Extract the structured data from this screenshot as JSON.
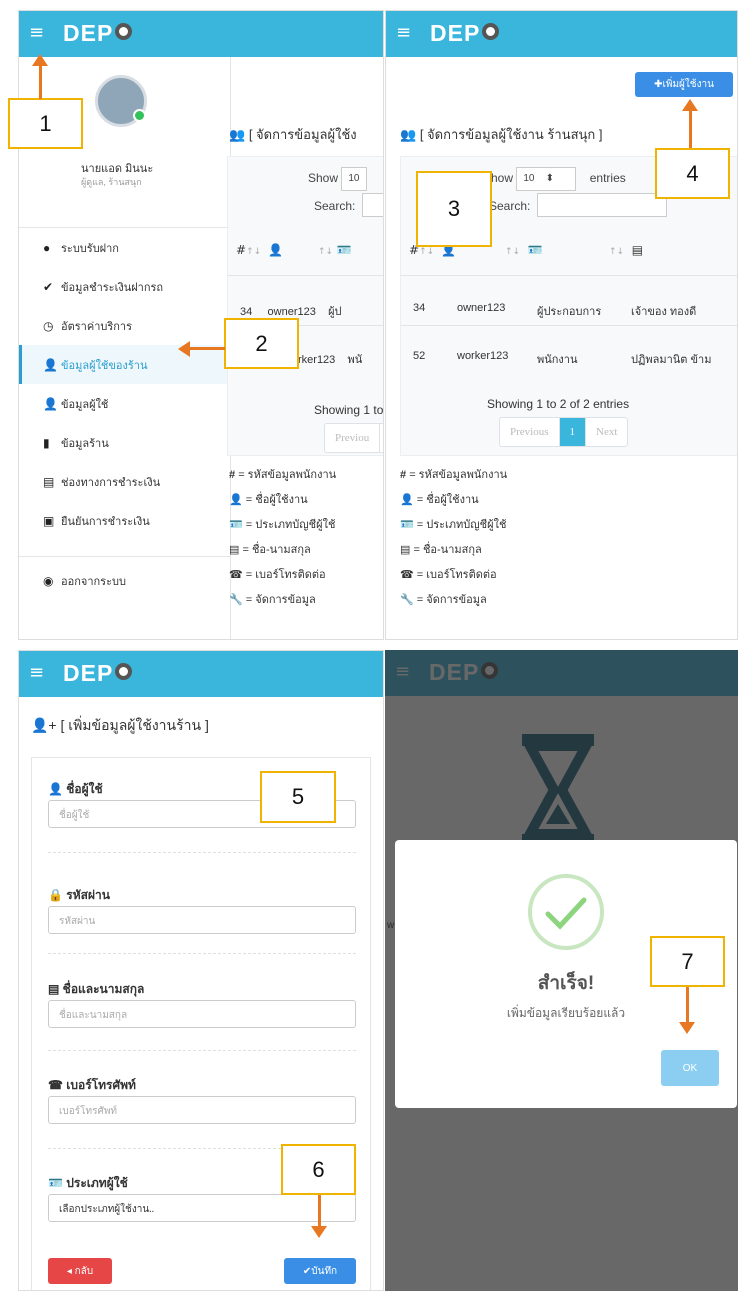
{
  "app": {
    "title": "DEP",
    "menu_icon": "≡"
  },
  "user": {
    "name": "นายแอด มินนะ",
    "role": "ผู้ดูแล, ร้านสนุก"
  },
  "sidebar": {
    "items": [
      {
        "label": "ระบบรับฝาก",
        "icon": "circle-icon"
      },
      {
        "label": "ข้อมูลชำระเงินฝากรถ",
        "icon": "check-icon"
      },
      {
        "label": "อัตราค่าบริการ",
        "icon": "clock-icon"
      },
      {
        "label": "ข้อมูลผู้ใช้ของร้าน",
        "icon": "user-icon"
      },
      {
        "label": "ข้อมูลผู้ใช้",
        "icon": "user-icon"
      },
      {
        "label": "ข้อมูลร้าน",
        "icon": "bookmark-icon"
      },
      {
        "label": "ช่องทางการชำระเงิน",
        "icon": "card-icon"
      },
      {
        "label": "ยืนยันการชำระเงิน",
        "icon": "money-icon"
      }
    ],
    "logout": "ออกจากระบบ"
  },
  "manage": {
    "heading_short": "[ จัดการข้อมูลผู้ใช้ง",
    "heading": "[ จัดการข้อมูลผู้ใช้งาน ร้านสนุก ]",
    "add_button": "เพิ่มผู้ใช้งาน",
    "show": "Show",
    "entries_value": "10",
    "entries": "entries",
    "search": "Search:",
    "rows": [
      {
        "id": "34",
        "user": "owner123",
        "type": "ผู้ประกอบการ",
        "name": "เจ้าของ ทองดี",
        "type_short": "ผู้ป",
        "user_short": "owner123"
      },
      {
        "id": "52",
        "user": "worker123",
        "type": "พนักงาน",
        "name": "ปฏิพลมานิต ข้าม",
        "type_short": "พนั",
        "user_short": "rker123"
      }
    ],
    "showing": "Showing 1 to 2 of 2 entries",
    "showing_short": "Showing 1 to",
    "previous": "Previous",
    "previous_short": "Previou",
    "page": "1",
    "next": "Next"
  },
  "legend": [
    {
      "sym": "#",
      "text": "= รหัสข้อมูลพนักงาน"
    },
    {
      "sym": "👤",
      "text": "= ชื่อผู้ใช้งาน"
    },
    {
      "sym": "🪪",
      "text": "= ประเภทบัญชีผู้ใช้"
    },
    {
      "sym": "▤",
      "text": "= ชื่อ-นามสกุล"
    },
    {
      "sym": "☎",
      "text": "= เบอร์โทรติดต่อ"
    },
    {
      "sym": "🔧",
      "text": "= จัดการข้อมูล"
    }
  ],
  "form": {
    "heading": "[ เพิ่มข้อมูลผู้ใช้งานร้าน ]",
    "username_label": "ชื่อผู้ใช้",
    "username_placeholder": "ชื่อผู้ใช้",
    "password_label": "รหัสผ่าน",
    "password_placeholder": "รหัสผ่าน",
    "fullname_label": "ชื่อและนามสกุล",
    "fullname_placeholder": "ชื่อและนามสกุล",
    "phone_label": "เบอร์โทรศัพท์",
    "phone_placeholder": "เบอร์โทรศัพท์",
    "type_label": "ประเภทผู้ใช้",
    "type_value": "เลือกประเภทผู้ใช้งาน..",
    "back": "◂ กลับ",
    "save": "✔บันทึก"
  },
  "dialog": {
    "title": "สำเร็จ!",
    "message": "เพิ่มข้อมูลเรียบร้อยแล้ว",
    "ok": "OK",
    "stray": "w"
  },
  "callouts": [
    "1",
    "2",
    "3",
    "4",
    "5",
    "6",
    "7"
  ],
  "colors": {
    "topbar": "#3ab6dd",
    "accent": "#e87722",
    "callout_border": "#f0b400",
    "danger": "#e64646",
    "primary": "#3a8ee6"
  }
}
